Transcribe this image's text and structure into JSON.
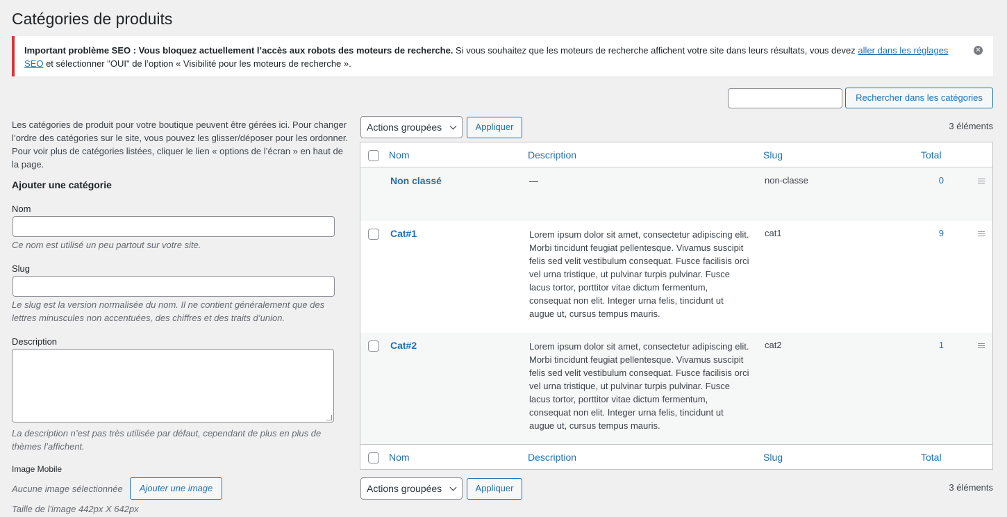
{
  "page": {
    "title": "Catégories de produits"
  },
  "notice": {
    "strong": "Important problème SEO : Vous bloquez actuellement l’accès aux robots des moteurs de recherche.",
    "text_before_link": " Si vous souhaitez que les moteurs de recherche affichent votre site dans leurs résultats, vous devez ",
    "link": "aller dans les réglages SEO",
    "text_after_link": " et sélectionner \"OUI\" de l’option « Visibilité pour les moteurs de recherche ».",
    "dismiss_icon": "close-circle-icon"
  },
  "search": {
    "value": "",
    "button_label": "Rechercher dans les catégories"
  },
  "left": {
    "intro": "Les catégories de produit pour votre boutique peuvent être gérées ici. Pour changer l’ordre des catégories sur le site, vous pouvez les glisser/déposer pour les ordonner. Pour voir plus de catégories listées, cliquer le lien « options de l’écran » en haut de la page.",
    "add_title": "Ajouter une catégorie",
    "name_label": "Nom",
    "name_value": "",
    "name_hint": "Ce nom est utilisé un peu partout sur votre site.",
    "slug_label": "Slug",
    "slug_value": "",
    "slug_hint": "Le slug est la version normalisée du nom. Il ne contient généralement que des lettres minuscules non accentuées, des chiffres et des traits d’union.",
    "description_label": "Description",
    "description_hint": "La description n’est pas très utilisée par défaut, cependant de plus en plus de thèmes l’affichent.",
    "image_label": "Image Mobile",
    "no_image": "Aucune image sélectionnée",
    "add_image_button": "Ajouter une image",
    "image_size": "Taille de l'image 442px X 642px"
  },
  "bulk": {
    "label": "Actions groupées",
    "apply": "Appliquer",
    "count": "3 éléments"
  },
  "table": {
    "columns": {
      "name": "Nom",
      "description": "Description",
      "slug": "Slug",
      "total": "Total"
    },
    "rows": [
      {
        "name": "Non classé",
        "description": "—",
        "slug": "non-classe",
        "total": "0"
      },
      {
        "name": "Cat#1",
        "description": "Lorem ipsum dolor sit amet, consectetur adipiscing elit. Morbi tincidunt feugiat pellentesque. Vivamus suscipit felis sed velit vestibulum consequat. Fusce facilisis orci vel urna tristique, ut pulvinar turpis pulvinar. Fusce lacus tortor, porttitor vitae dictum fermentum, consequat non elit. Integer urna felis, tincidunt ut augue ut, cursus tempus mauris.",
        "slug": "cat1",
        "total": "9"
      },
      {
        "name": "Cat#2",
        "description": "Lorem ipsum dolor sit amet, consectetur adipiscing elit. Morbi tincidunt feugiat pellentesque. Vivamus suscipit felis sed velit vestibulum consequat. Fusce facilisis orci vel urna tristique, ut pulvinar turpis pulvinar. Fusce lacus tortor, porttitor vitae dictum fermentum, consequat non elit. Integer urna felis, tincidunt ut augue ut, cursus tempus mauris.",
        "slug": "cat2",
        "total": "1"
      }
    ]
  },
  "colors": {
    "accent": "#2271b1",
    "error_border": "#d63638",
    "background": "#f0f0f1"
  }
}
